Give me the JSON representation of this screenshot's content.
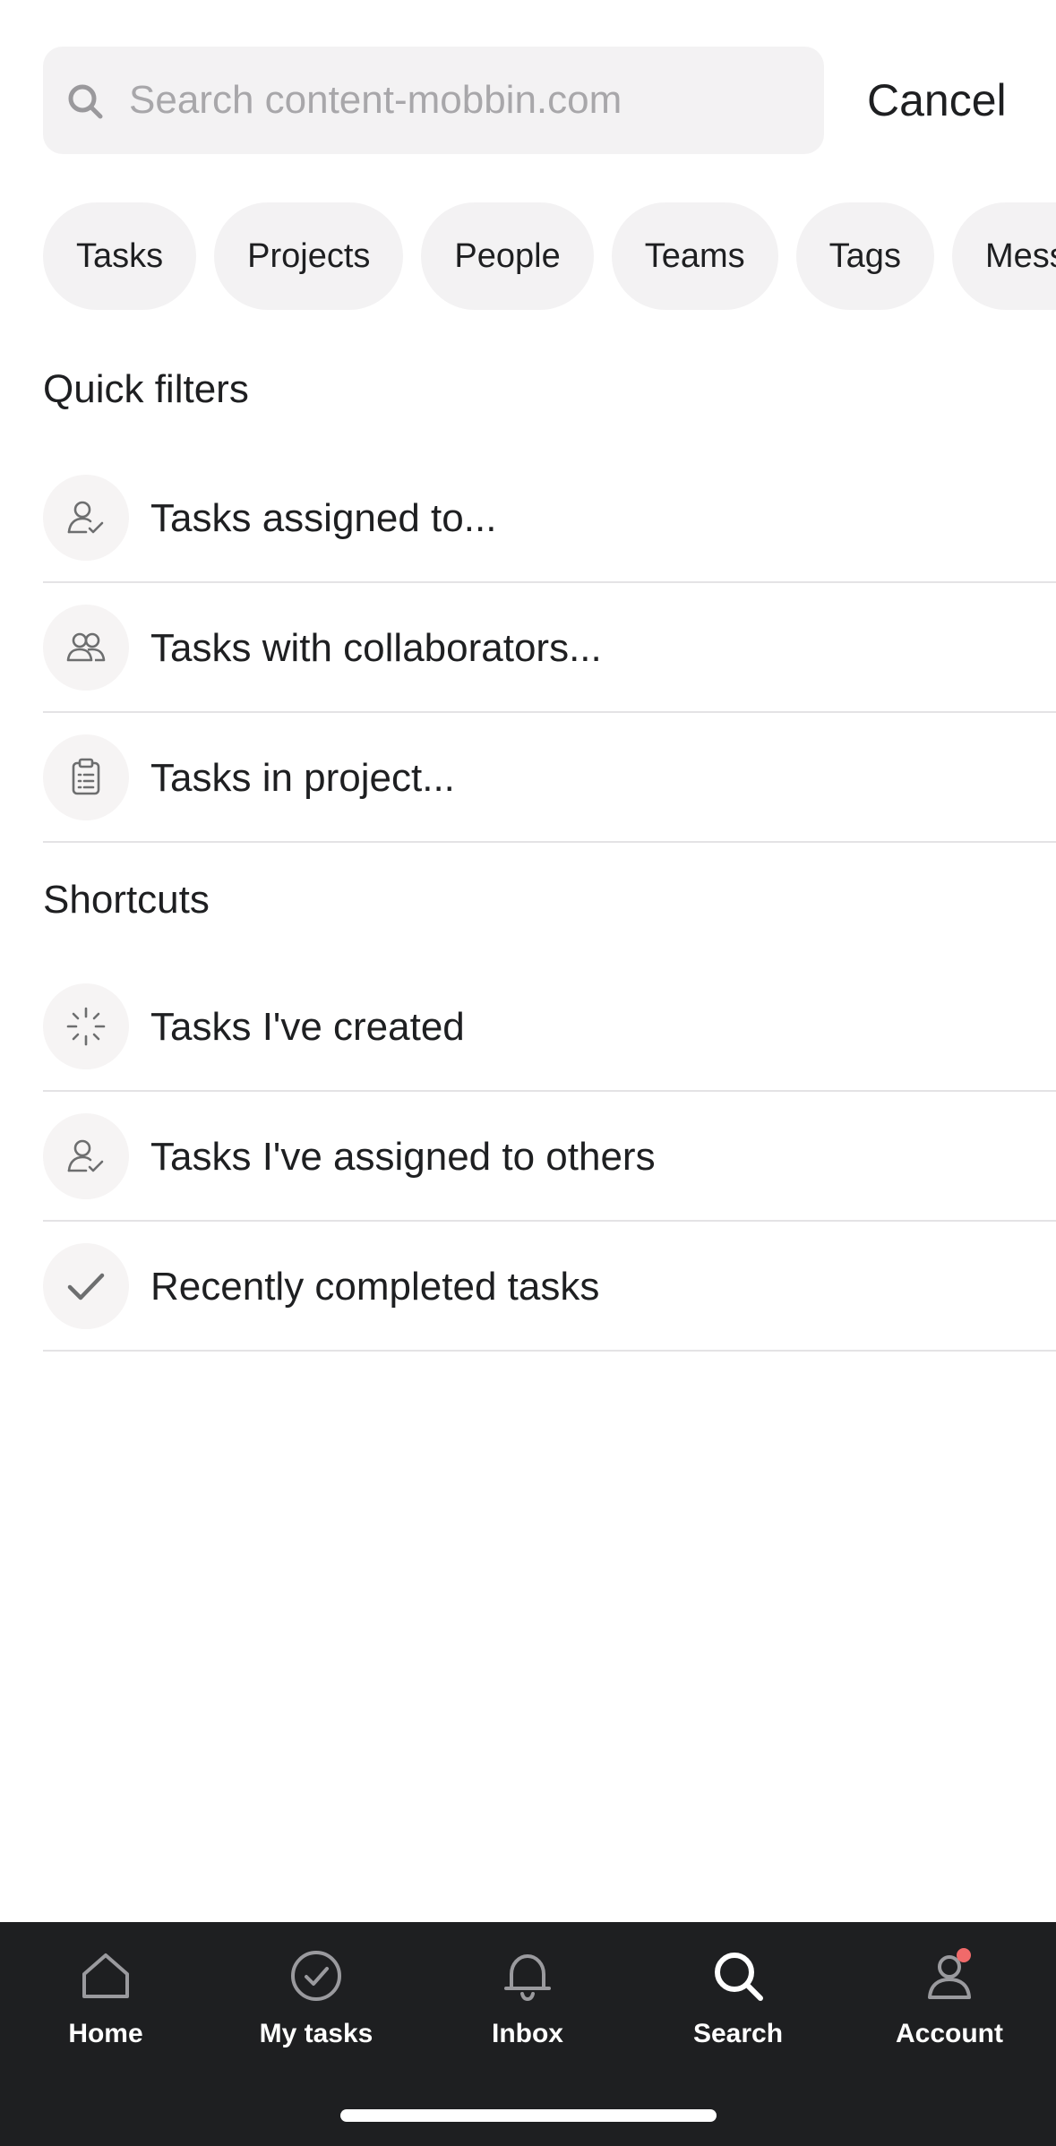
{
  "search": {
    "placeholder": "Search content-mobbin.com",
    "value": "",
    "cancel_label": "Cancel"
  },
  "chips": [
    {
      "label": "Tasks"
    },
    {
      "label": "Projects"
    },
    {
      "label": "People"
    },
    {
      "label": "Teams"
    },
    {
      "label": "Tags"
    },
    {
      "label": "Messages"
    }
  ],
  "quick_filters": {
    "title": "Quick filters",
    "items": [
      {
        "label": "Tasks assigned to...",
        "icon": "person-check-icon"
      },
      {
        "label": "Tasks with collaborators...",
        "icon": "people-icon"
      },
      {
        "label": "Tasks in project...",
        "icon": "clipboard-icon"
      }
    ]
  },
  "shortcuts": {
    "title": "Shortcuts",
    "items": [
      {
        "label": "Tasks I've created",
        "icon": "spark-icon"
      },
      {
        "label": "Tasks I've assigned to others",
        "icon": "person-check-icon"
      },
      {
        "label": "Recently completed tasks",
        "icon": "checkmark-icon"
      }
    ]
  },
  "nav": {
    "items": [
      {
        "label": "Home",
        "icon": "home-icon",
        "active": false
      },
      {
        "label": "My tasks",
        "icon": "check-circle-icon",
        "active": false
      },
      {
        "label": "Inbox",
        "icon": "bell-icon",
        "active": false
      },
      {
        "label": "Search",
        "icon": "search-icon",
        "active": true
      },
      {
        "label": "Account",
        "icon": "account-icon",
        "active": false,
        "badge": true
      }
    ]
  },
  "colors": {
    "background": "#ffffff",
    "chip_bg": "#f3f2f3",
    "nav_bg": "#1e1f21",
    "nav_inactive_icon": "#9a9a9e",
    "badge": "#f06a6a",
    "text": "#1e1f21",
    "placeholder": "#a8a7aa"
  }
}
